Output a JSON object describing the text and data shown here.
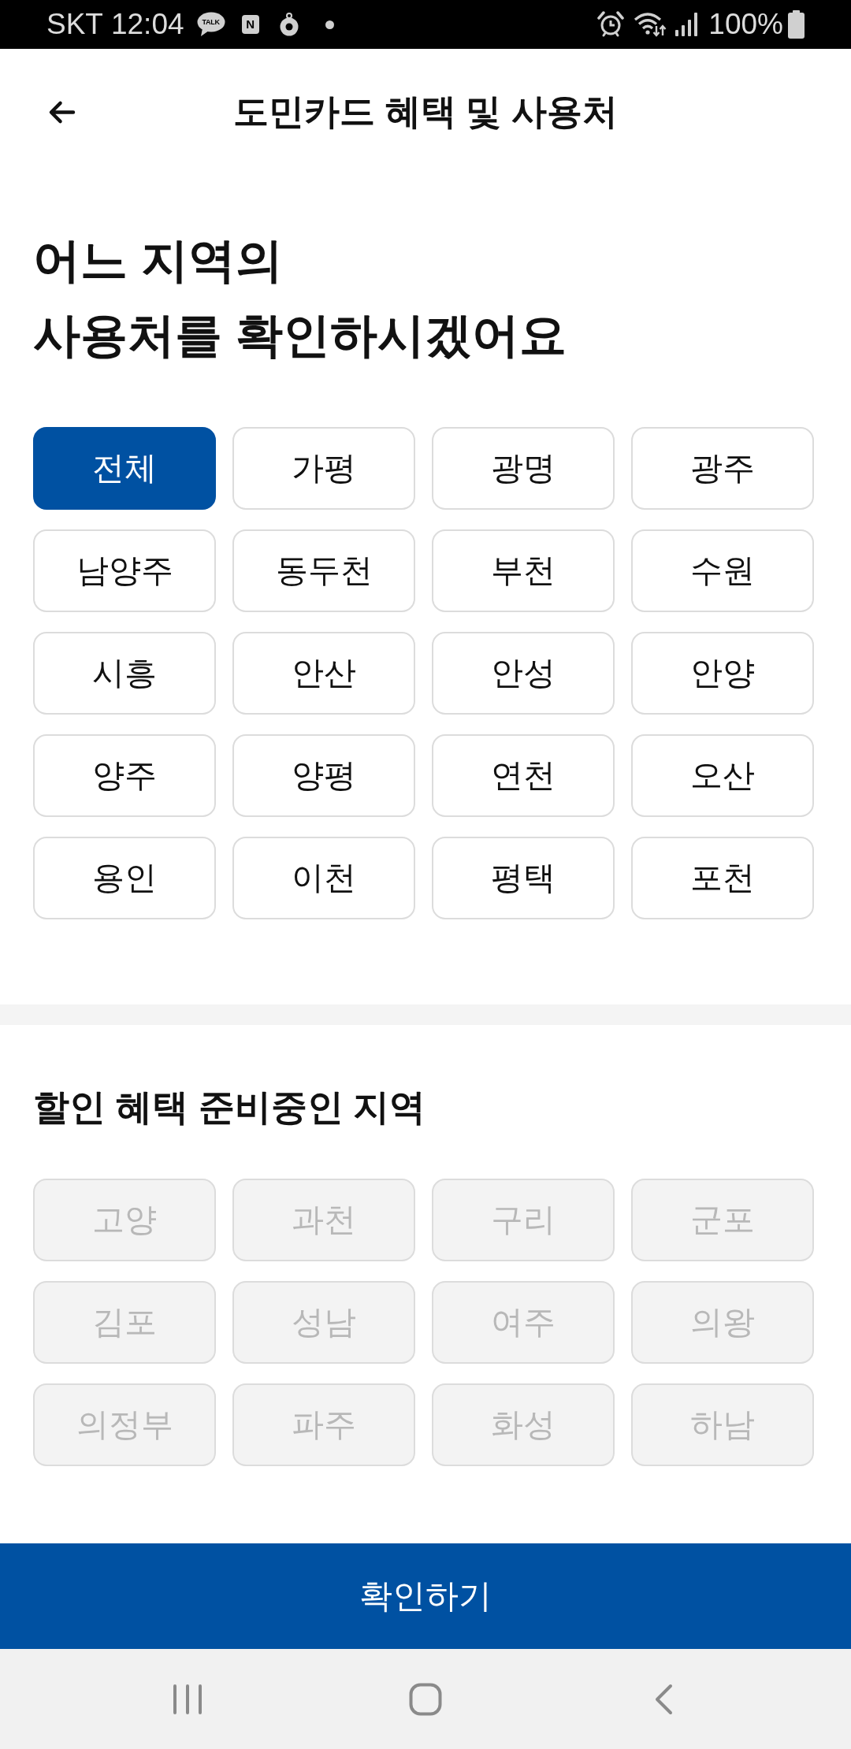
{
  "status_bar": {
    "carrier": "SKT",
    "time": "12:04",
    "notifications": [
      {
        "kind": "chat",
        "label": "TALK"
      },
      {
        "kind": "badge",
        "label": "N"
      },
      {
        "kind": "timer"
      },
      {
        "kind": "dot"
      }
    ],
    "battery": "100%"
  },
  "header": {
    "title": "도민카드 혜택 및 사용처"
  },
  "heading": "어느 지역의\n사용처를 확인하시겠어요",
  "regions": [
    {
      "label": "전체",
      "selected": true
    },
    {
      "label": "가평",
      "selected": false
    },
    {
      "label": "광명",
      "selected": false
    },
    {
      "label": "광주",
      "selected": false
    },
    {
      "label": "남양주",
      "selected": false
    },
    {
      "label": "동두천",
      "selected": false
    },
    {
      "label": "부천",
      "selected": false
    },
    {
      "label": "수원",
      "selected": false
    },
    {
      "label": "시흥",
      "selected": false
    },
    {
      "label": "안산",
      "selected": false
    },
    {
      "label": "안성",
      "selected": false
    },
    {
      "label": "안양",
      "selected": false
    },
    {
      "label": "양주",
      "selected": false
    },
    {
      "label": "양평",
      "selected": false
    },
    {
      "label": "연천",
      "selected": false
    },
    {
      "label": "오산",
      "selected": false
    },
    {
      "label": "용인",
      "selected": false
    },
    {
      "label": "이천",
      "selected": false
    },
    {
      "label": "평택",
      "selected": false
    },
    {
      "label": "포천",
      "selected": false
    }
  ],
  "pending_section": {
    "title": "할인 혜택 준비중인 지역",
    "regions": [
      {
        "label": "고양",
        "disabled": true
      },
      {
        "label": "과천",
        "disabled": true
      },
      {
        "label": "구리",
        "disabled": true
      },
      {
        "label": "군포",
        "disabled": true
      },
      {
        "label": "김포",
        "disabled": true
      },
      {
        "label": "성남",
        "disabled": true
      },
      {
        "label": "여주",
        "disabled": true
      },
      {
        "label": "의왕",
        "disabled": true
      },
      {
        "label": "의정부",
        "disabled": true
      },
      {
        "label": "파주",
        "disabled": true
      },
      {
        "label": "화성",
        "disabled": true
      },
      {
        "label": "하남",
        "disabled": true
      }
    ]
  },
  "confirm_button": {
    "label": "확인하기"
  }
}
